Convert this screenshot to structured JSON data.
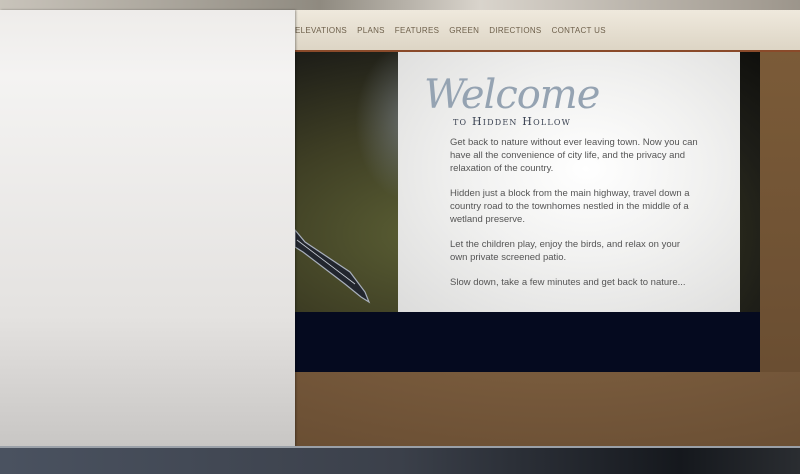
{
  "nav": {
    "items": [
      "ELEVATIONS",
      "PLANS",
      "FEATURES",
      "GREEN",
      "DIRECTIONS",
      "CONTACT US"
    ]
  },
  "welcome": {
    "title": "Welcome",
    "subtitle": "to Hidden Hollow"
  },
  "intro": {
    "p1": "Get back to nature without ever leaving town. Now you can have all the convenience of city life, and the privacy and relaxation of the country.",
    "p2": "Hidden just a block from the main highway, travel down a country road to the townhomes nestled in the middle of a wetland preserve.",
    "p3": "Let the children play, enjoy the birds, and relax on your own private screened patio.",
    "p4": "Slow down, take a few minutes and get back to nature..."
  },
  "colors": {
    "nav_text": "#6d5f4a",
    "title": "#95a3b2",
    "dark_band": "#050a1f",
    "background_brown": "#74573a"
  },
  "icons": {
    "hero": "dragonfly-wing-image"
  }
}
